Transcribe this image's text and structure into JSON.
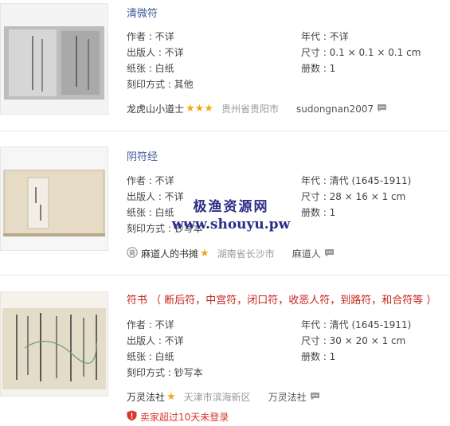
{
  "listings": [
    {
      "title": "清微符",
      "author": "作者 : 不详",
      "era": "年代 : 不详",
      "publisher": "出版人 : 不详",
      "size": "尺寸 : 0.1 × 0.1 × 0.1 cm",
      "paper": "纸张 : 白纸",
      "volumes": "册数 : 1",
      "print_method": "刻印方式 : 其他",
      "shop": "龙虎山小道士",
      "stars": "★★★",
      "location": "贵州省贵阳市",
      "seller_nick": "sudongnan2007"
    },
    {
      "title": "阴符经",
      "author": "作者 : 不详",
      "era": "年代 : 清代 (1645-1911)",
      "publisher": "出版人 : 不详",
      "size": "尺寸 : 28 × 16 × 1 cm",
      "paper": "纸张 : 白纸",
      "volumes": "册数 : 1",
      "print_method": "刻印方式 : 钞写本",
      "shop": "麻道人的书摊",
      "stars": "★",
      "location": "湖南省长沙市",
      "seller_nick": "麻道人"
    },
    {
      "title": "符书 （ 断后符，中宫符，闭口符，收恶人符，到路符，和合符等 ）",
      "author": "作者 : 不详",
      "era": "年代 : 清代 (1645-1911)",
      "publisher": "出版人 : 不详",
      "size": "尺寸 : 30 × 20 × 1 cm",
      "paper": "纸张 : 白纸",
      "volumes": "册数 : 1",
      "print_method": "刻印方式 : 钞写本",
      "shop": "万灵法社",
      "stars": "★",
      "location": "天津市滨海新区",
      "seller_nick": "万灵法社"
    }
  ],
  "warning_text": "卖家超过10天未登录",
  "watermark": {
    "line1": "极渔资源网",
    "line2": "www.shouyu.pw"
  },
  "colors": {
    "link": "#3b5998",
    "title_red": "#c4251c",
    "star": "#f2a81b",
    "warning": "#d9372b"
  }
}
